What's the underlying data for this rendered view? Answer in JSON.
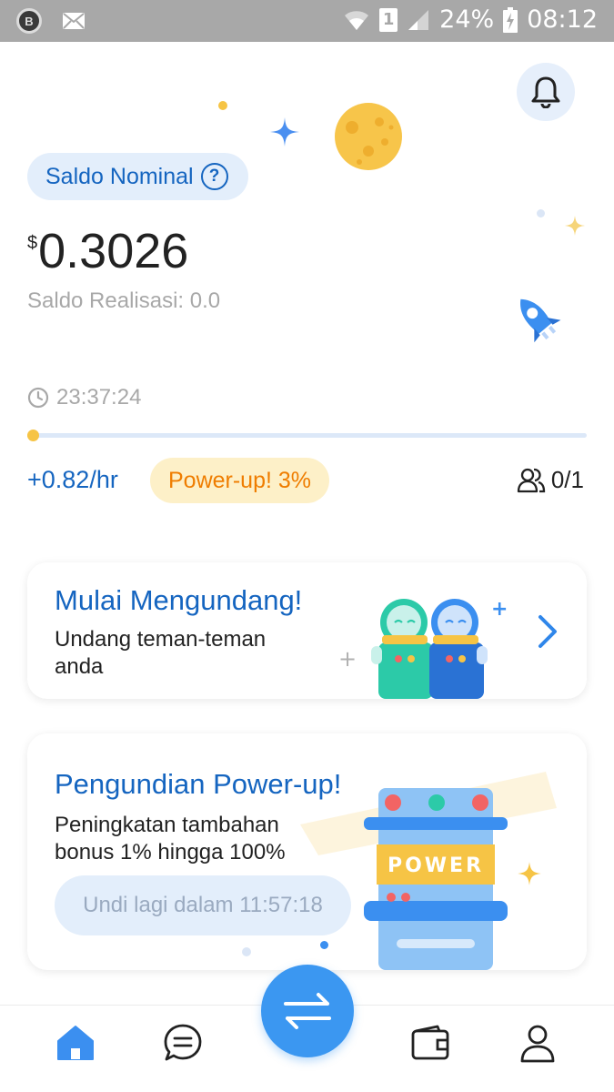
{
  "status_bar": {
    "left_icons": [
      "app-badge-icon",
      "mail-icon"
    ],
    "badge_letter": "B",
    "battery_percent": "24%",
    "time": "08:12",
    "sim_label": "1"
  },
  "header": {
    "bell_icon": "bell-icon"
  },
  "balance": {
    "label": "Saldo Nominal",
    "help_glyph": "?",
    "currency": "$",
    "amount": "0.3026",
    "realisasi": "Saldo Realisasi: 0.0"
  },
  "timer": {
    "value": "23:37:24",
    "progress_fraction": 0.01
  },
  "stats": {
    "rate": "+0.82/hr",
    "powerup": "Power-up! 3%",
    "team_count": "0/1"
  },
  "invite_card": {
    "title": "Mulai Mengundang!",
    "description": "Undang teman-teman anda"
  },
  "draw_card": {
    "title": "Pengundian Power-up!",
    "description": "Peningkatan tambahan bonus 1% hingga 100%",
    "button": "Undi lagi dalam 11:57:18",
    "machine_label": "POWER"
  },
  "colors": {
    "accent": "#1565c0",
    "fab": "#3b97f1",
    "powerup_text": "#ef7d00",
    "powerup_bg": "#fdf0c8"
  },
  "bottom_nav": {
    "items": [
      "home-icon",
      "chat-icon",
      "swap-icon",
      "wallet-icon",
      "profile-icon"
    ],
    "active": "home-icon"
  }
}
